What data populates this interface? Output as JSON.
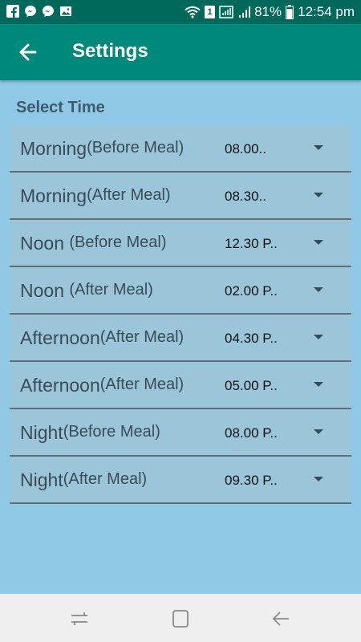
{
  "status_bar": {
    "battery": "81%",
    "time": "12:54 pm",
    "notification_badge": "1",
    "icons": [
      "facebook-icon",
      "messenger-icon",
      "messenger-icon",
      "gallery-icon",
      "wifi-icon",
      "sim-icon",
      "signal-icon",
      "battery-icon"
    ]
  },
  "app_bar": {
    "title": "Settings",
    "background": "#00897b"
  },
  "section": {
    "title": "Select Time"
  },
  "rows": [
    {
      "main": "Morning",
      "sub": "(Before Meal)",
      "value": "08.00.."
    },
    {
      "main": "Morning",
      "sub": "(After Meal)",
      "value": "08.30.."
    },
    {
      "main": "Noon ",
      "sub": "(Before Meal)",
      "value": "12.30 P.."
    },
    {
      "main": "Noon ",
      "sub": "(After Meal)",
      "value": "02.00 P.."
    },
    {
      "main": "Afternoon",
      "sub": "(After Meal)",
      "value": "04.30 P.."
    },
    {
      "main": "Afternoon",
      "sub": "(After Meal)",
      "value": "05.00 P.."
    },
    {
      "main": "Night",
      "sub": "(Before Meal)",
      "value": "08.00 P.."
    },
    {
      "main": "Night",
      "sub": "(After Meal)",
      "value": "09.30 P.."
    }
  ],
  "nav_bar": {
    "icons": [
      "recent-apps-icon",
      "home-icon",
      "back-nav-icon"
    ]
  }
}
